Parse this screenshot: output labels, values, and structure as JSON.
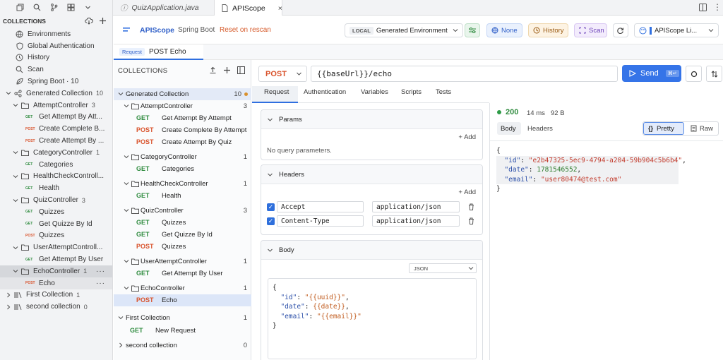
{
  "ide": {
    "collections_title": "COLLECTIONS",
    "tree": [
      {
        "type": "item",
        "icon": "globe-icon",
        "label": "Environments",
        "indent": 0
      },
      {
        "type": "item",
        "icon": "shield-icon",
        "label": "Global Authentication",
        "indent": 0
      },
      {
        "type": "item",
        "icon": "clock-icon",
        "label": "History",
        "indent": 0
      },
      {
        "type": "item",
        "icon": "search-icon",
        "label": "Scan",
        "indent": 0
      },
      {
        "type": "item",
        "icon": "leaf-icon",
        "label": "Spring Boot · 10",
        "indent": 0
      },
      {
        "type": "folder",
        "label": "Generated Collection",
        "count": "10",
        "indent": 0,
        "open": true,
        "icon": "graph-icon"
      },
      {
        "type": "folder",
        "label": "AttemptController",
        "count": "3",
        "indent": 1,
        "open": true
      },
      {
        "type": "req",
        "method": "GET",
        "label": "Get Attempt By Att...",
        "indent": 2
      },
      {
        "type": "req",
        "method": "POST",
        "label": "Create Complete B...",
        "indent": 2
      },
      {
        "type": "req",
        "method": "POST",
        "label": "Create Attempt By ...",
        "indent": 2
      },
      {
        "type": "folder",
        "label": "CategoryController",
        "count": "1",
        "indent": 1,
        "open": true
      },
      {
        "type": "req",
        "method": "GET",
        "label": "Categories",
        "indent": 2
      },
      {
        "type": "folder",
        "label": "HealthCheckControll...",
        "count": "",
        "indent": 1,
        "open": true
      },
      {
        "type": "req",
        "method": "GET",
        "label": "Health",
        "indent": 2
      },
      {
        "type": "folder",
        "label": "QuizController",
        "count": "3",
        "indent": 1,
        "open": true
      },
      {
        "type": "req",
        "method": "GET",
        "label": "Quizzes",
        "indent": 2
      },
      {
        "type": "req",
        "method": "GET",
        "label": "Get Quizze By Id",
        "indent": 2
      },
      {
        "type": "req",
        "method": "POST",
        "label": "Quizzes",
        "indent": 2
      },
      {
        "type": "folder",
        "label": "UserAttemptControll...",
        "count": "",
        "indent": 1,
        "open": true
      },
      {
        "type": "req",
        "method": "GET",
        "label": "Get Attempt By User",
        "indent": 2
      },
      {
        "type": "folder",
        "label": "EchoController",
        "count": "1",
        "indent": 1,
        "open": true,
        "selected": true,
        "dots": "···"
      },
      {
        "type": "req",
        "method": "POST",
        "label": "Echo",
        "indent": 2,
        "selected2": true,
        "dots": "···"
      },
      {
        "type": "coll",
        "label": "First Collection",
        "count": "1",
        "indent": 0,
        "open": false
      },
      {
        "type": "coll",
        "label": "second collection",
        "count": "0",
        "indent": 0,
        "open": false
      }
    ]
  },
  "file_tabs": [
    {
      "label": "QuizApplication.java",
      "active": false
    },
    {
      "label": "APIScope",
      "active": true,
      "close": "×"
    }
  ],
  "header": {
    "logo_text": "APIScope",
    "subtitle": "Spring Boot",
    "reset_link": "Reset on rescan",
    "env_badge": "LOCAL",
    "env_name": "Generated Environment",
    "none_btn": "None",
    "history_btn": "History",
    "scan_btn": "Scan",
    "lib_btn": "APIScope Li..."
  },
  "request_tab": {
    "badge": "Request",
    "label": "POST Echo"
  },
  "collections_panel": {
    "title": "COLLECTIONS",
    "rows": [
      {
        "kind": "root",
        "label": "Generated Collection",
        "count": "10",
        "dot": true
      },
      {
        "kind": "folder",
        "label": "AttemptController",
        "count": "3"
      },
      {
        "kind": "req",
        "method": "GET",
        "label": "Get Attempt By Attempt"
      },
      {
        "kind": "req",
        "method": "POST",
        "label": "Create Complete By Attempt"
      },
      {
        "kind": "req",
        "method": "POST",
        "label": "Create Attempt By Quiz"
      },
      {
        "kind": "folder",
        "label": "CategoryController",
        "count": "1"
      },
      {
        "kind": "req",
        "method": "GET",
        "label": "Categories"
      },
      {
        "kind": "folder",
        "label": "HealthCheckController",
        "count": "1"
      },
      {
        "kind": "req",
        "method": "GET",
        "label": "Health"
      },
      {
        "kind": "folder",
        "label": "QuizController",
        "count": "3"
      },
      {
        "kind": "req",
        "method": "GET",
        "label": "Quizzes"
      },
      {
        "kind": "req",
        "method": "GET",
        "label": "Get Quizze By Id"
      },
      {
        "kind": "req",
        "method": "POST",
        "label": "Quizzes"
      },
      {
        "kind": "folder",
        "label": "UserAttemptController",
        "count": "1"
      },
      {
        "kind": "req",
        "method": "GET",
        "label": "Get Attempt By User"
      },
      {
        "kind": "folder",
        "label": "EchoController",
        "count": "1"
      },
      {
        "kind": "req",
        "method": "POST",
        "label": "Echo",
        "selected": true
      },
      {
        "kind": "coll",
        "label": "First Collection",
        "count": "1"
      },
      {
        "kind": "req2",
        "method": "GET",
        "label": "New Request"
      },
      {
        "kind": "collclosed",
        "label": "second collection",
        "count": "0"
      }
    ]
  },
  "url_bar": {
    "method": "POST",
    "url": "{{baseUrl}}/echo",
    "send": "Send",
    "send_shortcut": "⌘↵"
  },
  "req_tabs": [
    "Request",
    "Authentication",
    "Variables",
    "Scripts",
    "Tests"
  ],
  "params": {
    "title": "Params",
    "add": "+ Add",
    "empty": "No query parameters."
  },
  "headers": {
    "title": "Headers",
    "add": "+ Add",
    "rows": [
      {
        "key": "Accept",
        "value": "application/json"
      },
      {
        "key": "Content-Type",
        "value": "application/json"
      }
    ]
  },
  "body": {
    "title": "Body",
    "format": "JSON",
    "lines": [
      [
        {
          "t": "{",
          "c": "p"
        }
      ],
      [
        {
          "t": "  \"id\"",
          "c": "key"
        },
        {
          "t": ": ",
          "c": "p"
        },
        {
          "t": "\"{{uuid}}\"",
          "c": "tpl"
        },
        {
          "t": ",",
          "c": "p"
        }
      ],
      [
        {
          "t": "  \"date\"",
          "c": "key"
        },
        {
          "t": ": ",
          "c": "p"
        },
        {
          "t": "{{date}}",
          "c": "tpl"
        },
        {
          "t": ",",
          "c": "p"
        }
      ],
      [
        {
          "t": "  \"email\"",
          "c": "key"
        },
        {
          "t": ": ",
          "c": "p"
        },
        {
          "t": "\"{{email}}\"",
          "c": "tpl"
        }
      ],
      [
        {
          "t": "}",
          "c": "p"
        }
      ]
    ]
  },
  "response": {
    "status": "200",
    "time": "14 ms",
    "size": "92 B",
    "tabs": [
      "Body",
      "Headers"
    ],
    "pretty": "Pretty",
    "raw": "Raw",
    "lines": [
      [
        {
          "t": "{",
          "c": "p"
        }
      ],
      [
        {
          "t": "  \"id\"",
          "c": "key"
        },
        {
          "t": ": ",
          "c": "p"
        },
        {
          "t": "\"e2b47325-5ec9-4794-a204-59b904c5b6b4\"",
          "c": "str"
        },
        {
          "t": ",",
          "c": "p"
        }
      ],
      [
        {
          "t": "  \"date\"",
          "c": "key"
        },
        {
          "t": ": ",
          "c": "p"
        },
        {
          "t": "1781546552",
          "c": "num"
        },
        {
          "t": ",",
          "c": "p"
        }
      ],
      [
        {
          "t": "  \"email\"",
          "c": "key"
        },
        {
          "t": ": ",
          "c": "p"
        },
        {
          "t": "\"user80474@test.com\"",
          "c": "str"
        }
      ],
      [
        {
          "t": "}",
          "c": "p"
        }
      ]
    ]
  }
}
